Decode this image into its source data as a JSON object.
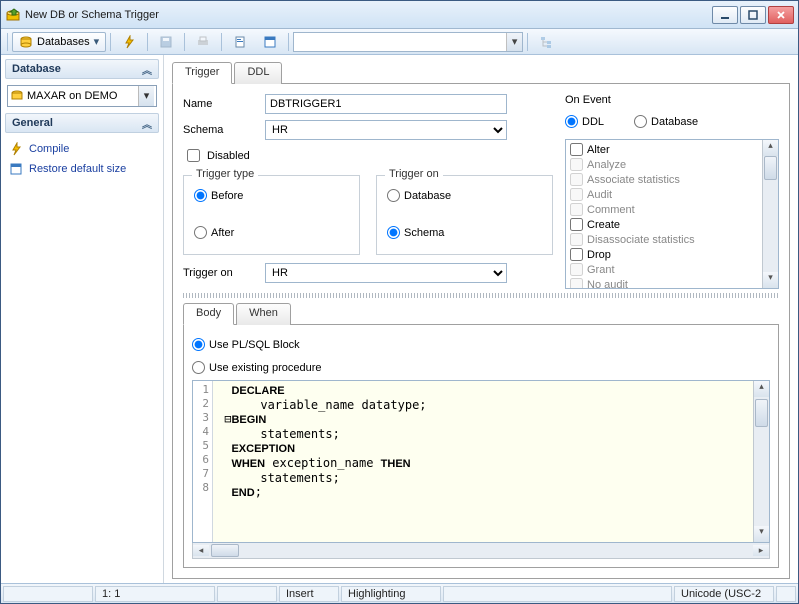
{
  "window": {
    "title": "New DB or Schema Trigger"
  },
  "toolbar": {
    "databases_label": "Databases"
  },
  "sidebar": {
    "database_header": "Database",
    "db_selected": "MAXAR on DEMO",
    "general_header": "General",
    "compile": "Compile",
    "restore": "Restore default size"
  },
  "tabs": {
    "trigger": "Trigger",
    "ddl": "DDL"
  },
  "form": {
    "name_label": "Name",
    "name_value": "DBTRIGGER1",
    "schema_label": "Schema",
    "schema_value": "HR",
    "disabled_label": "Disabled",
    "trigger_type_legend": "Trigger type",
    "before": "Before",
    "after": "After",
    "trigger_on_legend": "Trigger on",
    "on_database": "Database",
    "on_schema": "Schema",
    "trigger_on_label": "Trigger on",
    "trigger_on_value": "HR"
  },
  "onevent": {
    "legend": "On Event",
    "ddl": "DDL",
    "database": "Database",
    "items": [
      {
        "label": "Alter",
        "enabled": true,
        "checked": false
      },
      {
        "label": "Analyze",
        "enabled": false,
        "checked": false
      },
      {
        "label": "Associate statistics",
        "enabled": false,
        "checked": false
      },
      {
        "label": "Audit",
        "enabled": false,
        "checked": false
      },
      {
        "label": "Comment",
        "enabled": false,
        "checked": false
      },
      {
        "label": "Create",
        "enabled": true,
        "checked": false
      },
      {
        "label": "Disassociate statistics",
        "enabled": false,
        "checked": false
      },
      {
        "label": "Drop",
        "enabled": true,
        "checked": false
      },
      {
        "label": "Grant",
        "enabled": false,
        "checked": false
      },
      {
        "label": "No audit",
        "enabled": false,
        "checked": false
      }
    ]
  },
  "body": {
    "tab_body": "Body",
    "tab_when": "When",
    "use_plsql": "Use PL/SQL Block",
    "use_proc": "Use existing procedure",
    "lines": [
      "1",
      "2",
      "3",
      "4",
      "5",
      "6",
      "7",
      "8"
    ],
    "code": {
      "l1_kw": "DECLARE",
      "l2": "    variable_name datatype;",
      "l3_kw": "BEGIN",
      "l4": "    statements;",
      "l5_kw": "EXCEPTION",
      "l6a_kw": "WHEN",
      "l6b": " exception_name ",
      "l6c_kw": "THEN",
      "l7": "    statements;",
      "l8_kw": "END",
      "l8b": ";"
    }
  },
  "status": {
    "pos": "1:   1",
    "mode": "Insert",
    "highlight": "Highlighting",
    "encoding": "Unicode (USC-2"
  }
}
